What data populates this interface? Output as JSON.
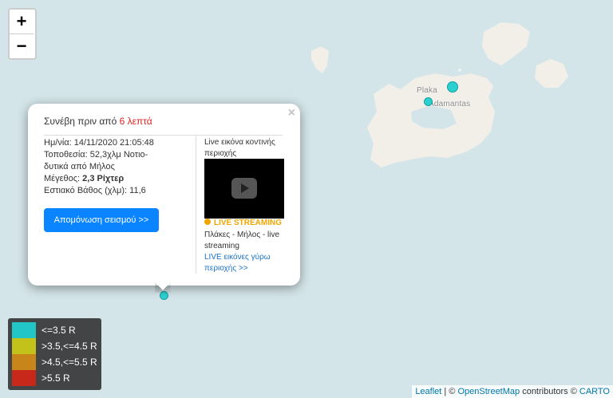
{
  "map": {
    "zoom_in": "+",
    "zoom_out": "−",
    "places": [
      "Plaka",
      "Adamantas"
    ]
  },
  "popup": {
    "close": "×",
    "head_prefix": "Συνέβη πριν από",
    "head_ago": "6 λεπτά",
    "date": "Ημ/νία: 14/11/2020 21:05:48",
    "location_line1": "Τοποθεσία: 52,3χλμ Νοτιο-",
    "location_line2": "δυτικά από Μήλος",
    "magnitude_label": "Μέγεθος:",
    "magnitude_value": "2,3 Ρίχτερ",
    "depth": "Εστιακό Βάθος (χλμ): 11,6",
    "isolate_button": "Απομόνωση σεισμού >>",
    "cam_heading": "Live εικόνα κοντινής περιοχής",
    "live_label": "LIVE STREAMING",
    "cam_title": "Πλάκες - Μήλος - live streaming",
    "cam_link": "LIVE εικόνες γύρω περιοχής >>"
  },
  "legend": [
    {
      "label": "<=3.5 R",
      "color": "#22c6c6"
    },
    {
      "label": ">3.5,<=4.5 R",
      "color": "#c2c21a"
    },
    {
      "label": ">4.5,<=5.5 R",
      "color": "#c8861a"
    },
    {
      "label": ">5.5 R",
      "color": "#c8281a"
    }
  ],
  "attribution": {
    "leaflet": "Leaflet",
    "sep": " | © ",
    "osm": "OpenStreetMap",
    "contributors": " contributors © ",
    "carto": "CARTO"
  },
  "colors": {
    "water": "#d4e5e9",
    "land": "#f2efe9",
    "marker": "#2dd0d0",
    "accent": "#0a84ff"
  }
}
